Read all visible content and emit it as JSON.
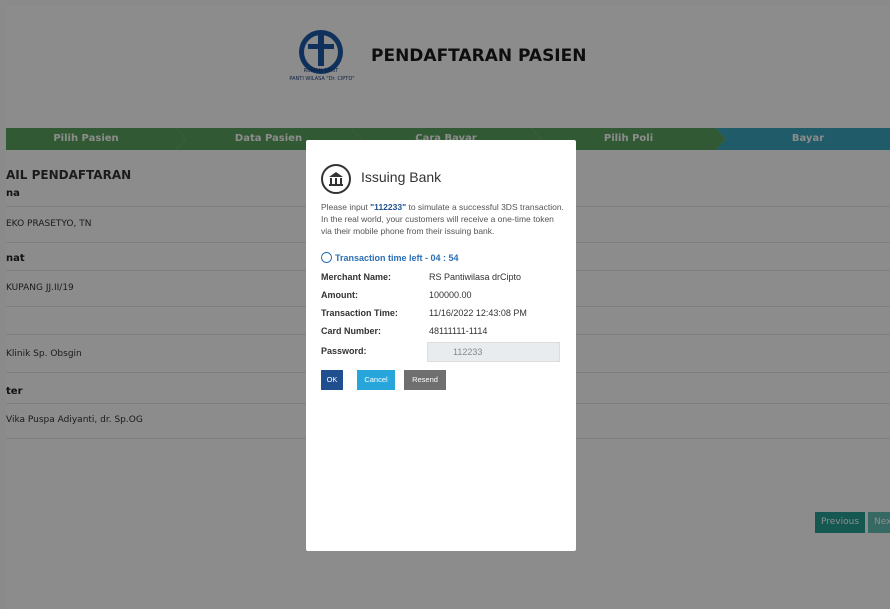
{
  "header": {
    "title": "PENDAFTARAN PASIEN",
    "logo_line1": "RUMAH SAKIT",
    "logo_line2": "PANTI WILASA \"Dr. CIPTO\""
  },
  "steps": [
    "Pilih Pasien",
    "Data Pasien",
    "Cara Bayar",
    "Pilih Poli",
    "Bayar"
  ],
  "background_form": {
    "section_title": "AIL PENDAFTARAN",
    "fields": [
      {
        "label": "na",
        "value": "EKO PRASETYO, TN"
      },
      {
        "label": "nat",
        "value": "KUPANG JJ.II/19"
      },
      {
        "label": "",
        "value": "Klinik Sp. Obsgin"
      },
      {
        "label": "ter",
        "value": "Vika Puspa Adiyanti, dr. Sp.OG"
      }
    ],
    "previous_label": "Previous",
    "next_label": "Next"
  },
  "modal": {
    "title": "Issuing Bank",
    "instructions_prefix": "Please input ",
    "instructions_code": "\"112233\"",
    "instructions_suffix": " to simulate a successful 3DS transaction. In the real world, your customers will receive a one-time token via their mobile phone from their issuing bank.",
    "timer_label": "Transaction time left - ",
    "timer_value": "04 : 54",
    "rows": [
      {
        "label": "Merchant Name:",
        "value": "RS Pantiwilasa drCipto"
      },
      {
        "label": "Amount:",
        "value": "100000.00"
      },
      {
        "label": "Transaction Time:",
        "value": "11/16/2022 12:43:08 PM"
      },
      {
        "label": "Card Number:",
        "value": "48111111-1114"
      },
      {
        "label": "Password:",
        "value": ""
      }
    ],
    "password_value": "112233",
    "ok_label": "OK",
    "cancel_label": "Cancel",
    "resend_label": "Resend"
  },
  "colors": {
    "step_green": "#5aa55f",
    "step_teal": "#3aa7bd",
    "ok_blue": "#1f4f8f",
    "cancel_cyan": "#27a6db",
    "resend_gray": "#6f6f6f",
    "pager_teal": "#27a195"
  }
}
